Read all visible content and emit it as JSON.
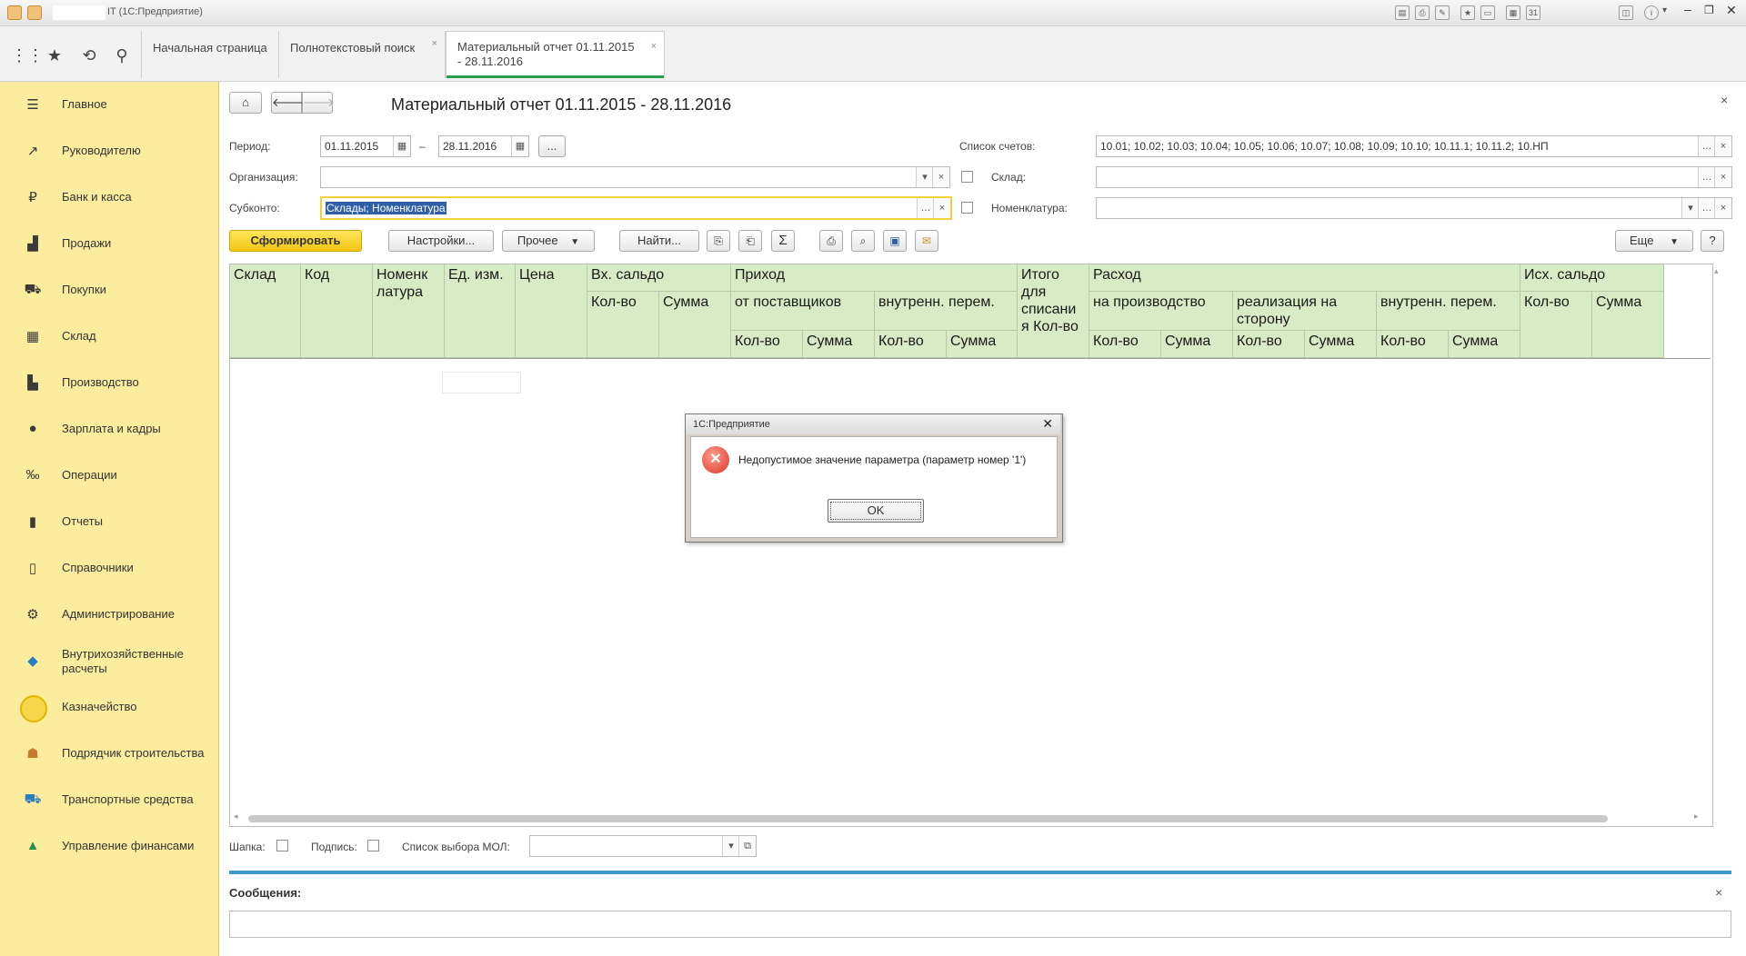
{
  "window": {
    "title": "IT  (1С:Предприятие)",
    "controls": [
      "minimize-icon",
      "restore-icon",
      "close-icon"
    ]
  },
  "tabs": [
    {
      "label": "Начальная страница",
      "closable": false,
      "active": false
    },
    {
      "label": "Полнотекстовый поиск",
      "closable": true,
      "active": false
    },
    {
      "label": "Материальный отчет 01.11.2015 - 28.11.2016",
      "closable": true,
      "active": true
    }
  ],
  "sidebar": {
    "items": [
      {
        "label": "Главное",
        "icon": "menu-icon"
      },
      {
        "label": "Руководителю",
        "icon": "chart-trend-icon"
      },
      {
        "label": "Банк и касса",
        "icon": "ruble-icon"
      },
      {
        "label": "Продажи",
        "icon": "bag-icon"
      },
      {
        "label": "Покупки",
        "icon": "cart-icon"
      },
      {
        "label": "Склад",
        "icon": "grid-icon"
      },
      {
        "label": "Производство",
        "icon": "factory-icon"
      },
      {
        "label": "Зарплата и кадры",
        "icon": "person-icon"
      },
      {
        "label": "Операции",
        "icon": "operations-icon"
      },
      {
        "label": "Отчеты",
        "icon": "bar-chart-icon"
      },
      {
        "label": "Справочники",
        "icon": "book-icon"
      },
      {
        "label": "Администрирование",
        "icon": "gear-icon"
      },
      {
        "label": "Внутрихозяйственные расчеты",
        "icon": "cube-icon"
      },
      {
        "label": "Казначейство",
        "icon": "coin-icon"
      },
      {
        "label": "Подрядчик строительства",
        "icon": "builder-icon"
      },
      {
        "label": "Транспортные средства",
        "icon": "truck-icon"
      },
      {
        "label": "Управление финансами",
        "icon": "finance-icon"
      }
    ]
  },
  "form": {
    "title": "Материальный отчет 01.11.2015 - 28.11.2016",
    "period_label": "Период:",
    "date_from": "01.11.2015",
    "date_sep": "–",
    "date_to": "28.11.2016",
    "period_more": "...",
    "org_label": "Организация:",
    "org_value": "",
    "subkonto_label": "Субконто:",
    "subkonto_value": "Склады; Номенклатура",
    "accounts_label": "Список счетов:",
    "accounts_value": "10.01; 10.02; 10.03; 10.04; 10.05; 10.06; 10.07; 10.08; 10.09; 10.10; 10.11.1; 10.11.2; 10.НП",
    "warehouse_label": "Склад:",
    "warehouse_value": "",
    "nomenclature_label": "Номенклатура:",
    "nomenclature_value": ""
  },
  "toolbar": {
    "generate": "Сформировать",
    "settings": "Настройки...",
    "other": "Прочее",
    "find": "Найти...",
    "more": "Еще",
    "help": "?"
  },
  "report_header": {
    "sklad": "Склад",
    "kod": "Код",
    "nomenk": "Номенк латура",
    "ed": "Ед. изм.",
    "cena": "Цена",
    "vh_saldo": "Вх. сальдо",
    "vh_kol": "Кол-во",
    "vh_sum": "Сумма",
    "prihod": "Приход",
    "ot_post": "от поставщиков",
    "vnutr1": "внутренн. перем.",
    "p_kol1": "Кол-во",
    "p_sum1": "Сумма",
    "p_kol2": "Кол-во",
    "p_sum2": "Сумма",
    "itogo": "Итого для списани я Кол-во",
    "rashod": "Расход",
    "na_proizv": "на производство",
    "realiz": "реализация на сторону",
    "vnutr2": "внутренн. перем.",
    "r_kol1": "Кол-во",
    "r_sum1": "Сумма",
    "r_kol2": "Кол-во",
    "r_sum2": "Сумма",
    "r_kol3": "Кол-во",
    "r_sum3": "Сумма",
    "ish_saldo": "Исх. сальдо",
    "ish_kol": "Кол-во",
    "ish_sum": "Сумма"
  },
  "bottom": {
    "shapka_label": "Шапка:",
    "podpis_label": "Подпись:",
    "mol_label": "Список выбора МОЛ:",
    "mol_value": "",
    "messages_label": "Сообщения:"
  },
  "dialog": {
    "title": "1С:Предприятие",
    "message": "Недопустимое значение параметра (параметр номер '1')",
    "ok": "OK"
  },
  "colors": {
    "sidebar_bg": "#fbec9e",
    "header_bg": "#d7ebc4",
    "accent_green": "#2a9d4a",
    "primary_button": "#f3c512",
    "messages_bar": "#3d9ad1"
  }
}
